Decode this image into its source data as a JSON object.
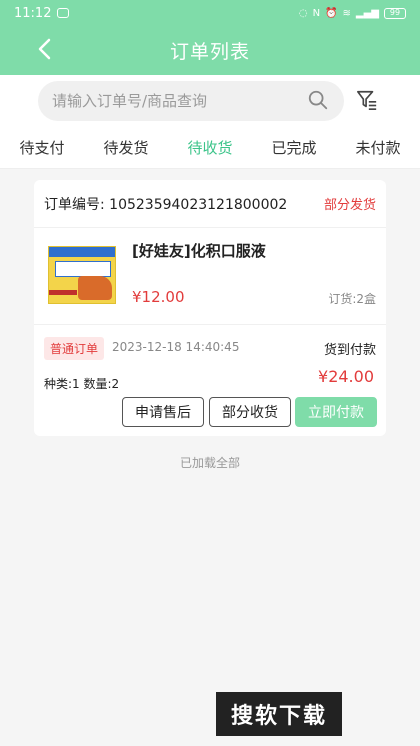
{
  "status_bar": {
    "time": "11:12",
    "battery": "99"
  },
  "header": {
    "title": "订单列表"
  },
  "search": {
    "placeholder": "请输入订单号/商品查询",
    "value": ""
  },
  "tabs": [
    {
      "label": "待支付"
    },
    {
      "label": "待发货"
    },
    {
      "label": "待收货"
    },
    {
      "label": "已完成"
    },
    {
      "label": "未付款"
    }
  ],
  "order": {
    "number_text": "订单编号: 10523594023121800002",
    "status": "部分发货",
    "product": {
      "name": "[好娃友]化积口服液",
      "price": "¥12.00",
      "quantity": "订货:2盒"
    },
    "tag": "普通订单",
    "time": "2023-12-18 14:40:45",
    "payment_method": "货到付款",
    "counts": "种类:1  数量:2",
    "total": "¥24.00",
    "buttons": {
      "after_sale": "申请售后",
      "partial_receive": "部分收货",
      "pay_now": "立即付款"
    }
  },
  "list_end": "已加载全部",
  "watermark": "搜软下载",
  "colors": {
    "accent": "#7fdca9",
    "active_tab": "#3cc48a",
    "price": "#e23c3c"
  }
}
